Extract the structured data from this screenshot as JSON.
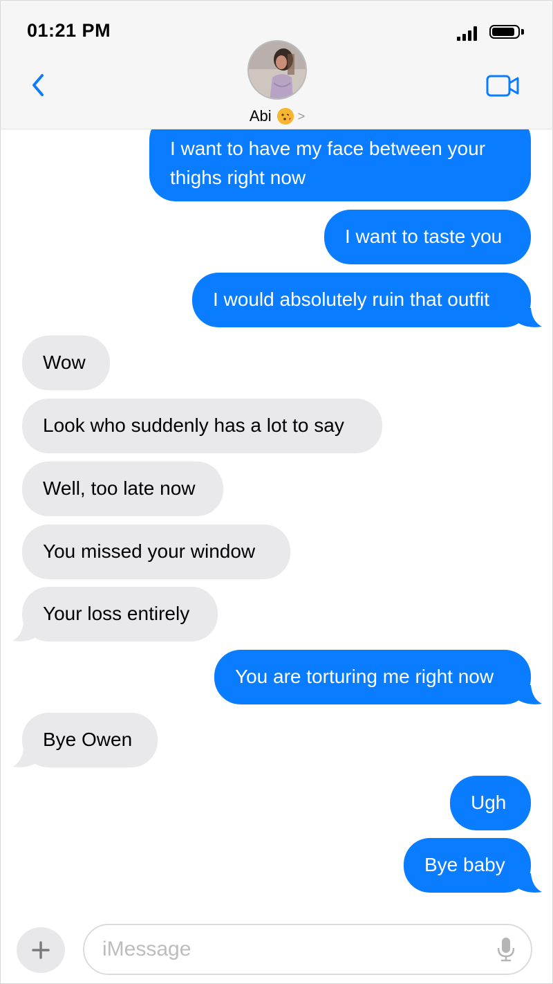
{
  "status_bar": {
    "time": "01:21 PM"
  },
  "header": {
    "contact_name": "Abi"
  },
  "colors": {
    "accent": "#0a7cff",
    "received_bubble": "#e9e9eb",
    "header_bg": "#f6f6f6"
  },
  "icons": {
    "back": "chevron-left-icon",
    "video": "video-camera-icon",
    "signal": "cellular-signal-icon",
    "battery": "battery-icon",
    "emoji": "kissing-face-emoji",
    "contact_chevron": "chevron-right-icon",
    "add": "plus-icon",
    "mic": "microphone-icon"
  },
  "messages": [
    {
      "from": "me",
      "text_lines": [
        "I want to have my face between your",
        "thighs right now"
      ]
    },
    {
      "from": "me",
      "text": "I want to taste you"
    },
    {
      "from": "me",
      "text": "I would absolutely ruin that outfit"
    },
    {
      "from": "them",
      "text": "Wow"
    },
    {
      "from": "them",
      "text": "Look who suddenly has a lot to say"
    },
    {
      "from": "them",
      "text": "Well, too late now"
    },
    {
      "from": "them",
      "text": "You missed your window"
    },
    {
      "from": "them",
      "text": "Your loss entirely"
    },
    {
      "from": "me",
      "text": "You are torturing me right now"
    },
    {
      "from": "them",
      "text": "Bye Owen"
    },
    {
      "from": "me",
      "text": "Ugh"
    },
    {
      "from": "me",
      "text": "Bye baby"
    }
  ],
  "composer": {
    "placeholder": "iMessage",
    "plus": "+"
  }
}
